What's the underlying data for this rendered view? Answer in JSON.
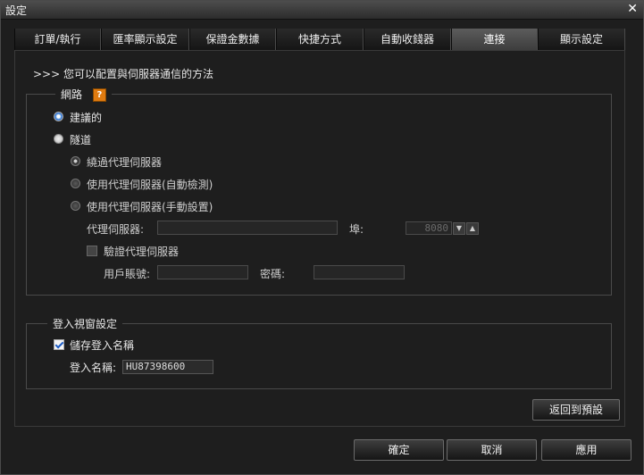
{
  "window": {
    "title": "設定",
    "close_glyph": "✕"
  },
  "tabs": [
    {
      "label": "訂單/執行"
    },
    {
      "label": "匯率顯示設定"
    },
    {
      "label": "保證金數據"
    },
    {
      "label": "快捷方式"
    },
    {
      "label": "自動收錢器"
    },
    {
      "label": "連接",
      "active": true
    },
    {
      "label": "顯示設定"
    }
  ],
  "intro": ">>> 您可以配置與伺服器通信的方法",
  "network": {
    "legend": "網路",
    "help_label": "?",
    "options": {
      "recommended": "建議的",
      "tunnel": "隧道"
    },
    "selected": "recommended",
    "proxy_options": {
      "bypass": "繞過代理伺服器",
      "auto": "使用代理伺服器(自動檢測)",
      "manual": "使用代理伺服器(手動設置)"
    },
    "proxy_selected": "bypass",
    "proxy_server_label": "代理伺服器:",
    "proxy_server_value": "",
    "port_label": "埠:",
    "port_value": "8080",
    "auth_label": "驗證代理伺服器",
    "username_label": "用戶賬號:",
    "username_value": "",
    "password_label": "密碼:",
    "password_value": ""
  },
  "login": {
    "legend": "登入視窗設定",
    "save_name_label": "儲存登入名稱",
    "save_name_checked": true,
    "name_label": "登入名稱:",
    "name_value": "HU87398600"
  },
  "buttons": {
    "reset": "返回到預設",
    "ok": "確定",
    "cancel": "取消",
    "apply": "應用"
  },
  "colors": {
    "accent_help": "#e07b10",
    "radio_selected": "#3a7bd5",
    "background": "#1e1e1e"
  }
}
